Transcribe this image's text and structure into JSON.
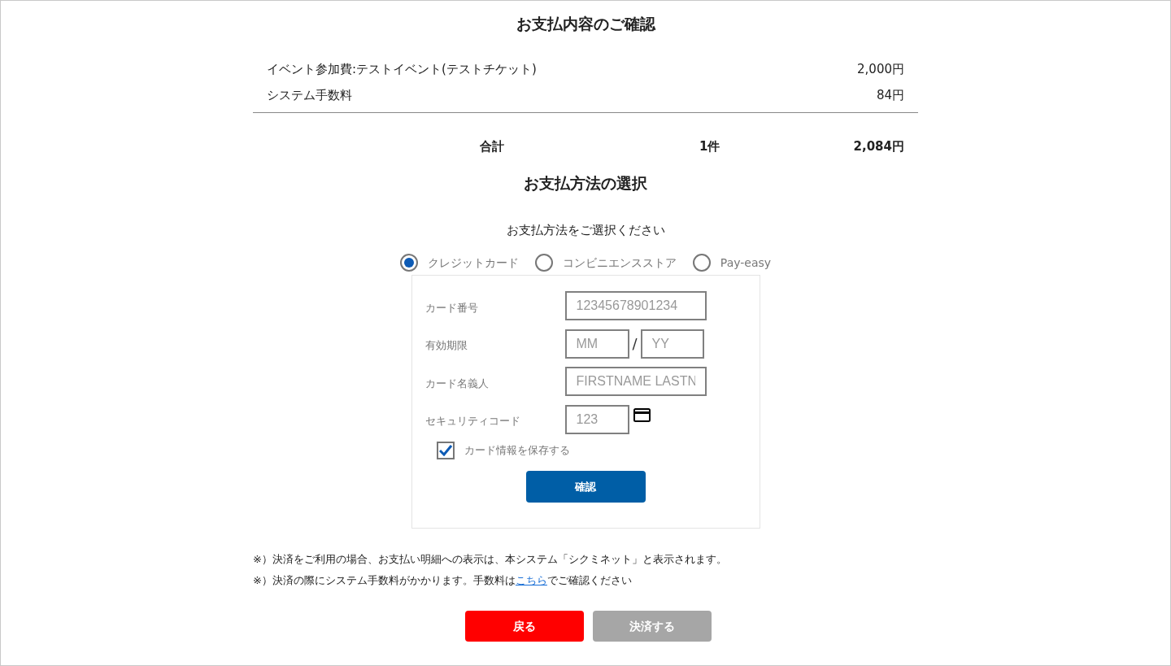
{
  "summary": {
    "title": "お支払内容のご確認",
    "items": [
      {
        "label": "イベント参加費:テストイベント(テストチケット)",
        "amount": "2,000円"
      },
      {
        "label": "システム手数料",
        "amount": "84円"
      }
    ],
    "total": {
      "label": "合計",
      "count": "1件",
      "amount": "2,084円"
    }
  },
  "payment": {
    "title": "お支払方法の選択",
    "prompt": "お支払方法をご選択ください",
    "methods": [
      {
        "label": "クレジットカード",
        "selected": true
      },
      {
        "label": "コンビニエンスストア",
        "selected": false
      },
      {
        "label": "Pay-easy",
        "selected": false
      }
    ],
    "card_form": {
      "fields": [
        {
          "kind": "single",
          "label": "カード番号",
          "placeholder": "12345678901234"
        },
        {
          "kind": "expiry",
          "label": "有効期限",
          "placeholder": "MM",
          "separator": "/",
          "placeholder_2": "YY"
        },
        {
          "kind": "single",
          "label": "カード名義人",
          "placeholder": "FIRSTNAME LASTN"
        },
        {
          "kind": "cvc",
          "label": "セキュリティコード",
          "placeholder": "123"
        }
      ],
      "save_card": {
        "label": "カード情報を保存する",
        "checked": true
      },
      "confirm_button": "確認"
    }
  },
  "notes": [
    {
      "text_before": "※）決済をご利用の場合、お支払い明細への表示は、本システム「シクミネット」と表示されます。"
    },
    {
      "text_before": "※）決済の際にシステム手数料がかかります。手数料は",
      "link": "こちら",
      "text_after": "でご確認ください"
    }
  ],
  "buttons": [
    {
      "label": "戻る",
      "kind": "back",
      "disabled": false
    },
    {
      "label": "決済する",
      "kind": "pay",
      "disabled": true
    }
  ]
}
